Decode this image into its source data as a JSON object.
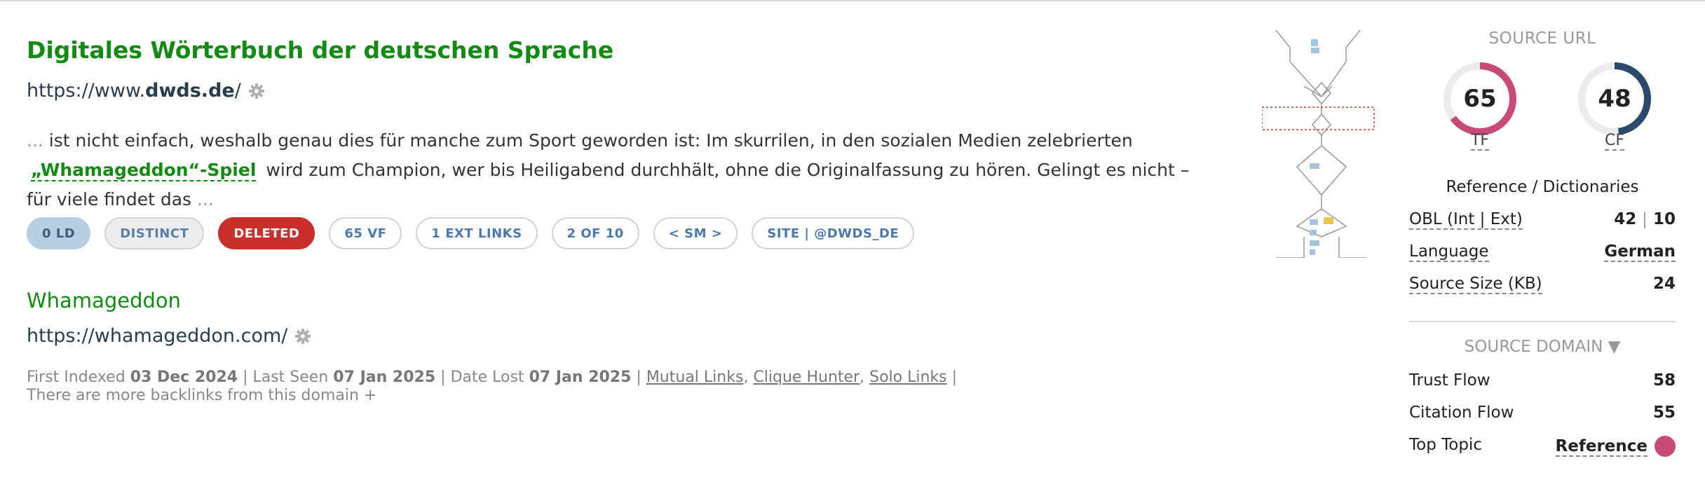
{
  "result1": {
    "title": "Digitales Wörterbuch der deutschen Sprache",
    "url_prefix": "https://www.",
    "url_domain": "dwds.de",
    "url_suffix": "/",
    "snippet_start": "... ",
    "snippet_before": "ist nicht einfach, weshalb genau dies für manche zum Sport geworden ist: Im skurrilen, in den sozialen Medien zelebrierten",
    "anchor": "„Whamageddon“-Spiel",
    "snippet_after": "wird zum Champion, wer bis Heiligabend durchhält, ohne die Originalfassung zu hören. Gelingt es nicht – für viele findet das",
    "snippet_end": " ...",
    "pills": [
      "0 LD",
      "DISTINCT",
      "DELETED",
      "65 VF",
      "1 EXT LINKS",
      "2 OF 10",
      "< SM >",
      "SITE | @DWDS_DE"
    ]
  },
  "result2": {
    "title": "Whamageddon",
    "url": "https://whamageddon.com/",
    "first_indexed_label": "First Indexed",
    "first_indexed": "03 Dec 2024",
    "last_seen_label": "Last Seen",
    "last_seen": "07 Jan 2025",
    "date_lost_label": "Date Lost",
    "date_lost": "07 Jan 2025",
    "links": [
      "Mutual Links",
      "Clique Hunter",
      "Solo Links"
    ],
    "more": "There are more backlinks from this domain +"
  },
  "source_url": {
    "heading": "SOURCE URL",
    "tf": "65",
    "tf_label": "TF",
    "cf": "48",
    "cf_label": "CF",
    "topic": "Reference / Dictionaries",
    "obl_label": "OBL (Int | Ext)",
    "obl_int": "42",
    "obl_ext": "10",
    "language_label": "Language",
    "language": "German",
    "size_label": "Source Size (KB)",
    "size": "24"
  },
  "source_domain": {
    "heading": "SOURCE DOMAIN ▼",
    "trust_flow_label": "Trust Flow",
    "trust_flow": "58",
    "citation_flow_label": "Citation Flow",
    "citation_flow": "55",
    "top_topic_label": "Top Topic",
    "top_topic": "Reference"
  },
  "colors": {
    "tf_arc": "#c94a78",
    "cf_arc": "#2a4a6b",
    "green": "#138a13",
    "deleted": "#c9302c"
  },
  "gauges": {
    "tf_fraction": 0.65,
    "cf_fraction": 0.48
  }
}
